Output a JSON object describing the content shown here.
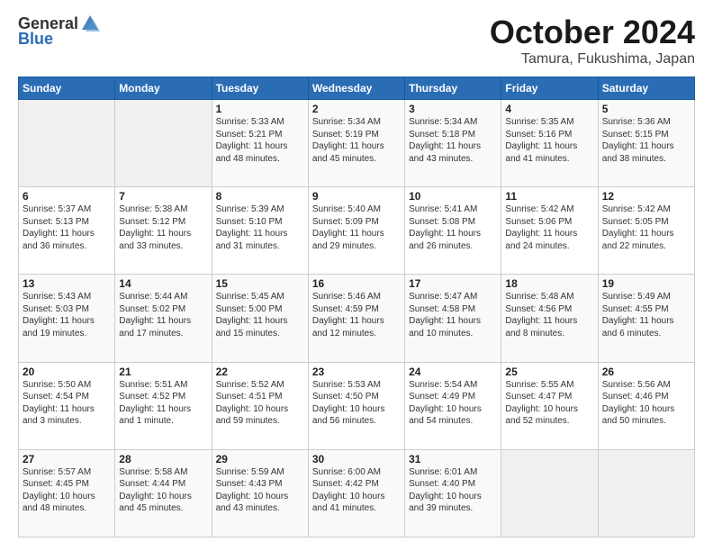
{
  "header": {
    "logo_general": "General",
    "logo_blue": "Blue",
    "month_title": "October 2024",
    "location": "Tamura, Fukushima, Japan"
  },
  "days_of_week": [
    "Sunday",
    "Monday",
    "Tuesday",
    "Wednesday",
    "Thursday",
    "Friday",
    "Saturday"
  ],
  "weeks": [
    [
      {
        "day": "",
        "content": ""
      },
      {
        "day": "",
        "content": ""
      },
      {
        "day": "1",
        "content": "Sunrise: 5:33 AM\nSunset: 5:21 PM\nDaylight: 11 hours and 48 minutes."
      },
      {
        "day": "2",
        "content": "Sunrise: 5:34 AM\nSunset: 5:19 PM\nDaylight: 11 hours and 45 minutes."
      },
      {
        "day": "3",
        "content": "Sunrise: 5:34 AM\nSunset: 5:18 PM\nDaylight: 11 hours and 43 minutes."
      },
      {
        "day": "4",
        "content": "Sunrise: 5:35 AM\nSunset: 5:16 PM\nDaylight: 11 hours and 41 minutes."
      },
      {
        "day": "5",
        "content": "Sunrise: 5:36 AM\nSunset: 5:15 PM\nDaylight: 11 hours and 38 minutes."
      }
    ],
    [
      {
        "day": "6",
        "content": "Sunrise: 5:37 AM\nSunset: 5:13 PM\nDaylight: 11 hours and 36 minutes."
      },
      {
        "day": "7",
        "content": "Sunrise: 5:38 AM\nSunset: 5:12 PM\nDaylight: 11 hours and 33 minutes."
      },
      {
        "day": "8",
        "content": "Sunrise: 5:39 AM\nSunset: 5:10 PM\nDaylight: 11 hours and 31 minutes."
      },
      {
        "day": "9",
        "content": "Sunrise: 5:40 AM\nSunset: 5:09 PM\nDaylight: 11 hours and 29 minutes."
      },
      {
        "day": "10",
        "content": "Sunrise: 5:41 AM\nSunset: 5:08 PM\nDaylight: 11 hours and 26 minutes."
      },
      {
        "day": "11",
        "content": "Sunrise: 5:42 AM\nSunset: 5:06 PM\nDaylight: 11 hours and 24 minutes."
      },
      {
        "day": "12",
        "content": "Sunrise: 5:42 AM\nSunset: 5:05 PM\nDaylight: 11 hours and 22 minutes."
      }
    ],
    [
      {
        "day": "13",
        "content": "Sunrise: 5:43 AM\nSunset: 5:03 PM\nDaylight: 11 hours and 19 minutes."
      },
      {
        "day": "14",
        "content": "Sunrise: 5:44 AM\nSunset: 5:02 PM\nDaylight: 11 hours and 17 minutes."
      },
      {
        "day": "15",
        "content": "Sunrise: 5:45 AM\nSunset: 5:00 PM\nDaylight: 11 hours and 15 minutes."
      },
      {
        "day": "16",
        "content": "Sunrise: 5:46 AM\nSunset: 4:59 PM\nDaylight: 11 hours and 12 minutes."
      },
      {
        "day": "17",
        "content": "Sunrise: 5:47 AM\nSunset: 4:58 PM\nDaylight: 11 hours and 10 minutes."
      },
      {
        "day": "18",
        "content": "Sunrise: 5:48 AM\nSunset: 4:56 PM\nDaylight: 11 hours and 8 minutes."
      },
      {
        "day": "19",
        "content": "Sunrise: 5:49 AM\nSunset: 4:55 PM\nDaylight: 11 hours and 6 minutes."
      }
    ],
    [
      {
        "day": "20",
        "content": "Sunrise: 5:50 AM\nSunset: 4:54 PM\nDaylight: 11 hours and 3 minutes."
      },
      {
        "day": "21",
        "content": "Sunrise: 5:51 AM\nSunset: 4:52 PM\nDaylight: 11 hours and 1 minute."
      },
      {
        "day": "22",
        "content": "Sunrise: 5:52 AM\nSunset: 4:51 PM\nDaylight: 10 hours and 59 minutes."
      },
      {
        "day": "23",
        "content": "Sunrise: 5:53 AM\nSunset: 4:50 PM\nDaylight: 10 hours and 56 minutes."
      },
      {
        "day": "24",
        "content": "Sunrise: 5:54 AM\nSunset: 4:49 PM\nDaylight: 10 hours and 54 minutes."
      },
      {
        "day": "25",
        "content": "Sunrise: 5:55 AM\nSunset: 4:47 PM\nDaylight: 10 hours and 52 minutes."
      },
      {
        "day": "26",
        "content": "Sunrise: 5:56 AM\nSunset: 4:46 PM\nDaylight: 10 hours and 50 minutes."
      }
    ],
    [
      {
        "day": "27",
        "content": "Sunrise: 5:57 AM\nSunset: 4:45 PM\nDaylight: 10 hours and 48 minutes."
      },
      {
        "day": "28",
        "content": "Sunrise: 5:58 AM\nSunset: 4:44 PM\nDaylight: 10 hours and 45 minutes."
      },
      {
        "day": "29",
        "content": "Sunrise: 5:59 AM\nSunset: 4:43 PM\nDaylight: 10 hours and 43 minutes."
      },
      {
        "day": "30",
        "content": "Sunrise: 6:00 AM\nSunset: 4:42 PM\nDaylight: 10 hours and 41 minutes."
      },
      {
        "day": "31",
        "content": "Sunrise: 6:01 AM\nSunset: 4:40 PM\nDaylight: 10 hours and 39 minutes."
      },
      {
        "day": "",
        "content": ""
      },
      {
        "day": "",
        "content": ""
      }
    ]
  ]
}
